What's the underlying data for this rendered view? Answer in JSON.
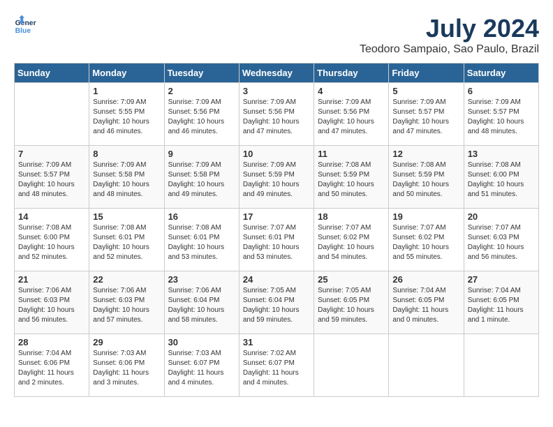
{
  "header": {
    "logo_line1": "General",
    "logo_line2": "Blue",
    "month": "July 2024",
    "location": "Teodoro Sampaio, Sao Paulo, Brazil"
  },
  "weekdays": [
    "Sunday",
    "Monday",
    "Tuesday",
    "Wednesday",
    "Thursday",
    "Friday",
    "Saturday"
  ],
  "weeks": [
    [
      {
        "day": "",
        "info": ""
      },
      {
        "day": "1",
        "info": "Sunrise: 7:09 AM\nSunset: 5:55 PM\nDaylight: 10 hours\nand 46 minutes."
      },
      {
        "day": "2",
        "info": "Sunrise: 7:09 AM\nSunset: 5:56 PM\nDaylight: 10 hours\nand 46 minutes."
      },
      {
        "day": "3",
        "info": "Sunrise: 7:09 AM\nSunset: 5:56 PM\nDaylight: 10 hours\nand 47 minutes."
      },
      {
        "day": "4",
        "info": "Sunrise: 7:09 AM\nSunset: 5:56 PM\nDaylight: 10 hours\nand 47 minutes."
      },
      {
        "day": "5",
        "info": "Sunrise: 7:09 AM\nSunset: 5:57 PM\nDaylight: 10 hours\nand 47 minutes."
      },
      {
        "day": "6",
        "info": "Sunrise: 7:09 AM\nSunset: 5:57 PM\nDaylight: 10 hours\nand 48 minutes."
      }
    ],
    [
      {
        "day": "7",
        "info": "Sunrise: 7:09 AM\nSunset: 5:57 PM\nDaylight: 10 hours\nand 48 minutes."
      },
      {
        "day": "8",
        "info": "Sunrise: 7:09 AM\nSunset: 5:58 PM\nDaylight: 10 hours\nand 48 minutes."
      },
      {
        "day": "9",
        "info": "Sunrise: 7:09 AM\nSunset: 5:58 PM\nDaylight: 10 hours\nand 49 minutes."
      },
      {
        "day": "10",
        "info": "Sunrise: 7:09 AM\nSunset: 5:59 PM\nDaylight: 10 hours\nand 49 minutes."
      },
      {
        "day": "11",
        "info": "Sunrise: 7:08 AM\nSunset: 5:59 PM\nDaylight: 10 hours\nand 50 minutes."
      },
      {
        "day": "12",
        "info": "Sunrise: 7:08 AM\nSunset: 5:59 PM\nDaylight: 10 hours\nand 50 minutes."
      },
      {
        "day": "13",
        "info": "Sunrise: 7:08 AM\nSunset: 6:00 PM\nDaylight: 10 hours\nand 51 minutes."
      }
    ],
    [
      {
        "day": "14",
        "info": "Sunrise: 7:08 AM\nSunset: 6:00 PM\nDaylight: 10 hours\nand 52 minutes."
      },
      {
        "day": "15",
        "info": "Sunrise: 7:08 AM\nSunset: 6:01 PM\nDaylight: 10 hours\nand 52 minutes."
      },
      {
        "day": "16",
        "info": "Sunrise: 7:08 AM\nSunset: 6:01 PM\nDaylight: 10 hours\nand 53 minutes."
      },
      {
        "day": "17",
        "info": "Sunrise: 7:07 AM\nSunset: 6:01 PM\nDaylight: 10 hours\nand 53 minutes."
      },
      {
        "day": "18",
        "info": "Sunrise: 7:07 AM\nSunset: 6:02 PM\nDaylight: 10 hours\nand 54 minutes."
      },
      {
        "day": "19",
        "info": "Sunrise: 7:07 AM\nSunset: 6:02 PM\nDaylight: 10 hours\nand 55 minutes."
      },
      {
        "day": "20",
        "info": "Sunrise: 7:07 AM\nSunset: 6:03 PM\nDaylight: 10 hours\nand 56 minutes."
      }
    ],
    [
      {
        "day": "21",
        "info": "Sunrise: 7:06 AM\nSunset: 6:03 PM\nDaylight: 10 hours\nand 56 minutes."
      },
      {
        "day": "22",
        "info": "Sunrise: 7:06 AM\nSunset: 6:03 PM\nDaylight: 10 hours\nand 57 minutes."
      },
      {
        "day": "23",
        "info": "Sunrise: 7:06 AM\nSunset: 6:04 PM\nDaylight: 10 hours\nand 58 minutes."
      },
      {
        "day": "24",
        "info": "Sunrise: 7:05 AM\nSunset: 6:04 PM\nDaylight: 10 hours\nand 59 minutes."
      },
      {
        "day": "25",
        "info": "Sunrise: 7:05 AM\nSunset: 6:05 PM\nDaylight: 10 hours\nand 59 minutes."
      },
      {
        "day": "26",
        "info": "Sunrise: 7:04 AM\nSunset: 6:05 PM\nDaylight: 11 hours\nand 0 minutes."
      },
      {
        "day": "27",
        "info": "Sunrise: 7:04 AM\nSunset: 6:05 PM\nDaylight: 11 hours\nand 1 minute."
      }
    ],
    [
      {
        "day": "28",
        "info": "Sunrise: 7:04 AM\nSunset: 6:06 PM\nDaylight: 11 hours\nand 2 minutes."
      },
      {
        "day": "29",
        "info": "Sunrise: 7:03 AM\nSunset: 6:06 PM\nDaylight: 11 hours\nand 3 minutes."
      },
      {
        "day": "30",
        "info": "Sunrise: 7:03 AM\nSunset: 6:07 PM\nDaylight: 11 hours\nand 4 minutes."
      },
      {
        "day": "31",
        "info": "Sunrise: 7:02 AM\nSunset: 6:07 PM\nDaylight: 11 hours\nand 4 minutes."
      },
      {
        "day": "",
        "info": ""
      },
      {
        "day": "",
        "info": ""
      },
      {
        "day": "",
        "info": ""
      }
    ]
  ]
}
